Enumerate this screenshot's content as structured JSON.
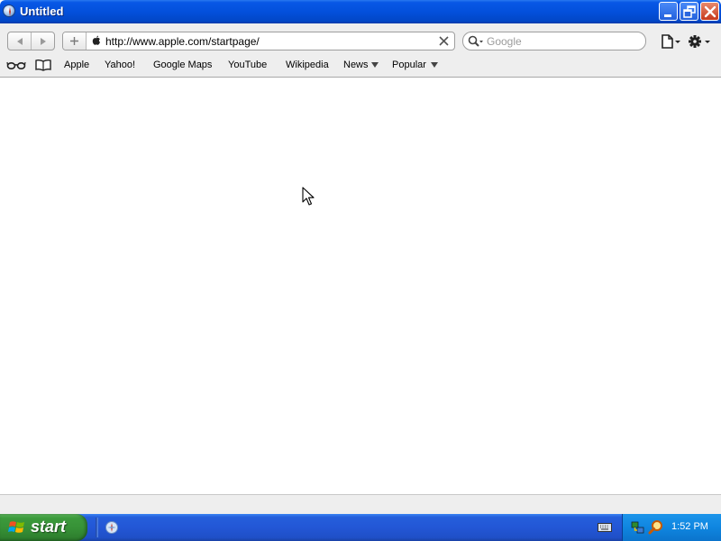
{
  "window": {
    "title": "Untitled"
  },
  "toolbar": {
    "url": "http://www.apple.com/startpage/",
    "search_placeholder": "Google"
  },
  "bookmarks": {
    "items": [
      "Apple",
      "Yahoo!",
      "Google Maps",
      "YouTube",
      "Wikipedia",
      "News",
      "Popular"
    ]
  },
  "taskbar": {
    "start_label": "start",
    "clock": "1:52 PM"
  },
  "icons": {
    "titlebar": [
      "safari-app-icon",
      "minimize-icon",
      "restore-icon",
      "close-icon"
    ],
    "toolbar": [
      "back-arrow-icon",
      "forward-arrow-icon",
      "add-bookmark-icon",
      "apple-logo-icon",
      "clear-url-icon",
      "search-icon",
      "page-menu-icon",
      "gear-icon"
    ],
    "bookmarks": [
      "reading-glasses-icon",
      "book-icon"
    ],
    "taskbar": [
      "windows-logo-icon",
      "safari-task-icon",
      "keyboard-icon",
      "network-icon",
      "search-tray-icon"
    ],
    "content": [
      "mouse-cursor-icon"
    ]
  },
  "colors": {
    "titlebar": "#0350dc",
    "chrome": "#eeeeee",
    "taskbar": "#245edb",
    "start_button": "#379237",
    "tray": "#0f86e0"
  }
}
